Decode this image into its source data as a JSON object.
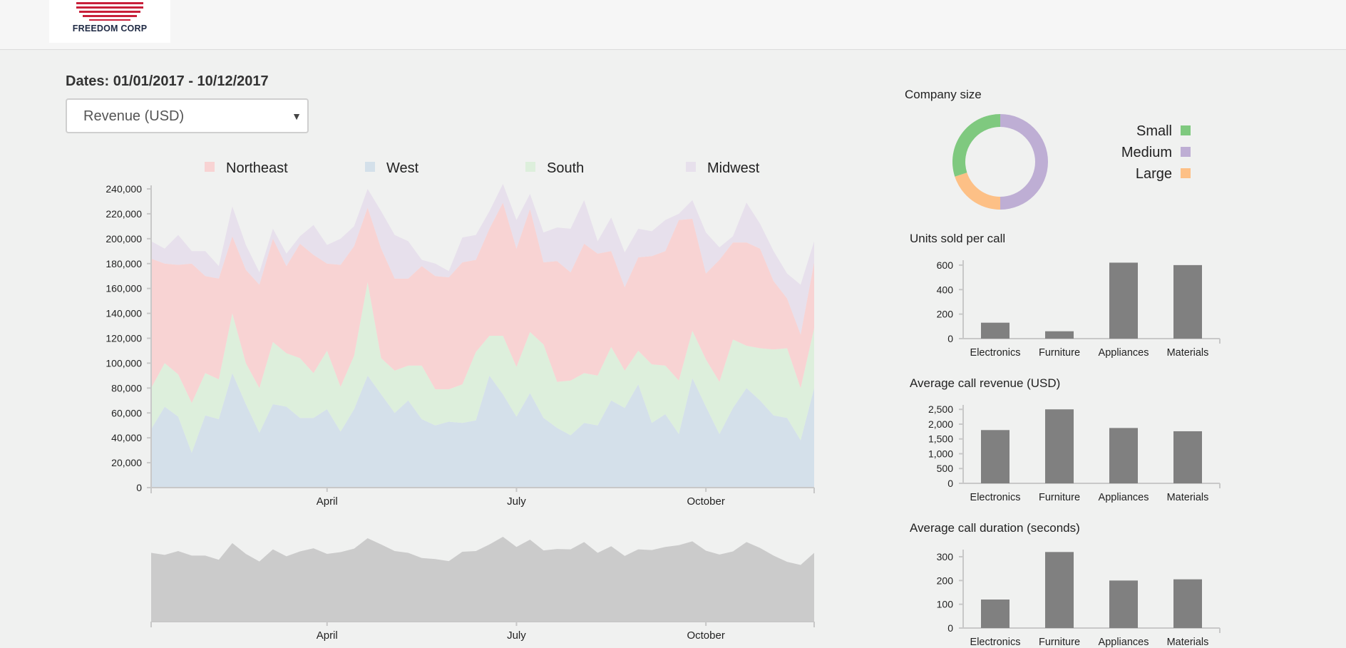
{
  "header": {
    "brand": "FREEDOM CORP"
  },
  "filters": {
    "dates_label": "Dates: 01/01/2017 - 10/12/2017",
    "metric_selected": "Revenue (USD)"
  },
  "colors": {
    "northeast": "#f8d3d3",
    "west": "#d4e0ea",
    "south": "#ddefdc",
    "midwest": "#e7e0ec",
    "brush": "#cbcbcb",
    "small": "#7fc97f",
    "medium": "#beaed4",
    "large": "#fdc086",
    "bar": "#808080"
  },
  "chart_data": [
    {
      "type": "area",
      "stacked": true,
      "legend_position": "top",
      "x_ticks": [
        "April",
        "July",
        "October"
      ],
      "x_tick_index": [
        13,
        27,
        41
      ],
      "ylim": [
        0,
        240000
      ],
      "y_ticks": [
        "0",
        "20,000",
        "40,000",
        "60,000",
        "80,000",
        "100,000",
        "120,000",
        "140,000",
        "160,000",
        "180,000",
        "200,000",
        "220,000",
        "240,000"
      ],
      "series": [
        {
          "name": "West",
          "values": [
            47000,
            65000,
            57000,
            28000,
            58000,
            55000,
            92000,
            67000,
            44000,
            67000,
            65000,
            56000,
            56000,
            63000,
            45000,
            63000,
            90000,
            75000,
            60000,
            70000,
            55000,
            50000,
            53000,
            52000,
            54000,
            90000,
            75000,
            57000,
            76000,
            56000,
            48000,
            42000,
            52000,
            50000,
            70000,
            64000,
            83000,
            52000,
            59000,
            43000,
            88000,
            65000,
            43000,
            64000,
            80000,
            70000,
            58000,
            56000,
            38000,
            80000
          ]
        },
        {
          "name": "South",
          "values": [
            33000,
            35000,
            34000,
            40000,
            34000,
            32000,
            48000,
            33000,
            36000,
            50000,
            43000,
            48000,
            36000,
            47000,
            36000,
            43000,
            75000,
            29000,
            34000,
            28000,
            43000,
            29000,
            26000,
            31000,
            55000,
            32000,
            47000,
            40000,
            49000,
            59000,
            37000,
            44000,
            40000,
            40000,
            43000,
            30000,
            27000,
            47000,
            39000,
            43000,
            38000,
            38000,
            42000,
            55000,
            34000,
            42000,
            53000,
            56000,
            42000,
            48000
          ]
        },
        {
          "name": "Northeast",
          "values": [
            104000,
            80000,
            88000,
            112000,
            78000,
            81000,
            62000,
            75000,
            83000,
            83000,
            70000,
            92000,
            95000,
            70000,
            98000,
            88000,
            60000,
            88000,
            74000,
            70000,
            80000,
            91000,
            90000,
            98000,
            74000,
            86000,
            107000,
            95000,
            99000,
            66000,
            97000,
            87000,
            104000,
            98000,
            77000,
            67000,
            75000,
            87000,
            92000,
            129000,
            90000,
            69000,
            98000,
            78000,
            83000,
            80000,
            55000,
            40000,
            43000,
            53000
          ]
        },
        {
          "name": "Midwest",
          "values": [
            14000,
            12000,
            24000,
            10000,
            20000,
            10000,
            24000,
            20000,
            10000,
            8000,
            10000,
            6000,
            24000,
            15000,
            21000,
            16000,
            15000,
            30000,
            35000,
            30000,
            5000,
            10000,
            5000,
            20000,
            20000,
            14000,
            15000,
            23000,
            12000,
            24000,
            27000,
            35000,
            35000,
            10000,
            27000,
            28000,
            23000,
            20000,
            25000,
            5000,
            15000,
            33000,
            10000,
            5000,
            32000,
            20000,
            24000,
            20000,
            40000,
            17000
          ]
        }
      ]
    },
    {
      "type": "area",
      "role": "overview-brush",
      "x_ticks": [
        "April",
        "July",
        "October"
      ],
      "x_tick_index": [
        13,
        27,
        41
      ],
      "ylim": [
        0,
        240000
      ],
      "series": [
        {
          "values": [
            198000,
            192000,
            203000,
            190000,
            190000,
            178000,
            226000,
            195000,
            173000,
            208000,
            188000,
            202000,
            211000,
            195000,
            200000,
            210000,
            240000,
            222000,
            203000,
            198000,
            183000,
            180000,
            174000,
            201000,
            203000,
            222000,
            244000,
            215000,
            236000,
            205000,
            209000,
            208000,
            229000,
            198000,
            217000,
            189000,
            208000,
            206000,
            215000,
            220000,
            231000,
            204000,
            193000,
            202000,
            229000,
            212000,
            190000,
            172000,
            163000,
            198000
          ]
        }
      ]
    },
    {
      "type": "pie",
      "title": "Company size",
      "legend_position": "right",
      "categories": [
        "Small",
        "Medium",
        "Large"
      ],
      "values": [
        30,
        50,
        20
      ]
    },
    {
      "type": "bar",
      "title": "Units sold per call",
      "categories": [
        "Electronics",
        "Furniture",
        "Appliances",
        "Materials"
      ],
      "values": [
        130,
        60,
        620,
        600
      ],
      "ylim": [
        0,
        640
      ],
      "y_ticks": [
        0,
        200,
        400,
        600
      ]
    },
    {
      "type": "bar",
      "title": "Average call revenue (USD)",
      "categories": [
        "Electronics",
        "Furniture",
        "Appliances",
        "Materials"
      ],
      "values": [
        1800,
        2500,
        1870,
        1760
      ],
      "ylim": [
        0,
        2650
      ],
      "y_ticks": [
        0,
        500,
        1000,
        1500,
        2000,
        2500
      ],
      "y_tick_labels": [
        "0",
        "500",
        "1,000",
        "1,500",
        "2,000",
        "2,500"
      ]
    },
    {
      "type": "bar",
      "title": "Average call duration (seconds)",
      "categories": [
        "Electronics",
        "Furniture",
        "Appliances",
        "Materials"
      ],
      "values": [
        120,
        320,
        200,
        205
      ],
      "ylim": [
        0,
        330
      ],
      "y_ticks": [
        0,
        100,
        200,
        300
      ]
    }
  ]
}
